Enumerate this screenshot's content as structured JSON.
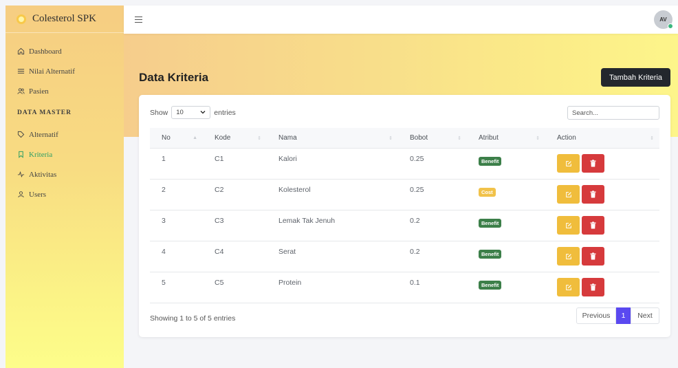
{
  "brand": {
    "name": "Colesterol SPK"
  },
  "sidebar": {
    "items": [
      {
        "label": "Dashboard",
        "icon": "home-icon"
      },
      {
        "label": "Nilai Alternatif",
        "icon": "list-icon"
      },
      {
        "label": "Pasien",
        "icon": "users-icon"
      }
    ],
    "section_title": "DATA MASTER",
    "master_items": [
      {
        "label": "Alternatif",
        "icon": "tag-icon"
      },
      {
        "label": "Kriteria",
        "icon": "bookmark-icon",
        "active": true
      },
      {
        "label": "Aktivitas",
        "icon": "activity-icon"
      },
      {
        "label": "Users",
        "icon": "user-icon"
      }
    ],
    "active_color": "#2e9e66"
  },
  "topbar": {
    "avatar_initials": "AV",
    "status_color": "#3bb77e"
  },
  "page": {
    "title": "Data Kriteria",
    "add_button": "Tambah Kriteria"
  },
  "table_controls": {
    "show_label": "Show",
    "entries_value": "10",
    "entries_label": "entries",
    "search_placeholder": "Search..."
  },
  "table": {
    "columns": [
      "No",
      "Kode",
      "Nama",
      "Bobot",
      "Atribut",
      "Action"
    ],
    "rows": [
      {
        "no": "1",
        "kode": "C1",
        "nama": "Kalori",
        "bobot": "0.25",
        "atribut": "Benefit"
      },
      {
        "no": "2",
        "kode": "C2",
        "nama": "Kolesterol",
        "bobot": "0.25",
        "atribut": "Cost"
      },
      {
        "no": "3",
        "kode": "C3",
        "nama": "Lemak Tak Jenuh",
        "bobot": "0.2",
        "atribut": "Benefit"
      },
      {
        "no": "4",
        "kode": "C4",
        "nama": "Serat",
        "bobot": "0.2",
        "atribut": "Benefit"
      },
      {
        "no": "5",
        "kode": "C5",
        "nama": "Protein",
        "bobot": "0.1",
        "atribut": "Benefit"
      }
    ]
  },
  "footer": {
    "info": "Showing 1 to 5 of 5 entries",
    "previous": "Previous",
    "current_page": "1",
    "next": "Next"
  },
  "colors": {
    "benefit": "#3c7f49",
    "cost": "#f1c24a",
    "edit": "#f0bd3c",
    "delete": "#d63a3c",
    "page_active": "#5a49f0"
  }
}
